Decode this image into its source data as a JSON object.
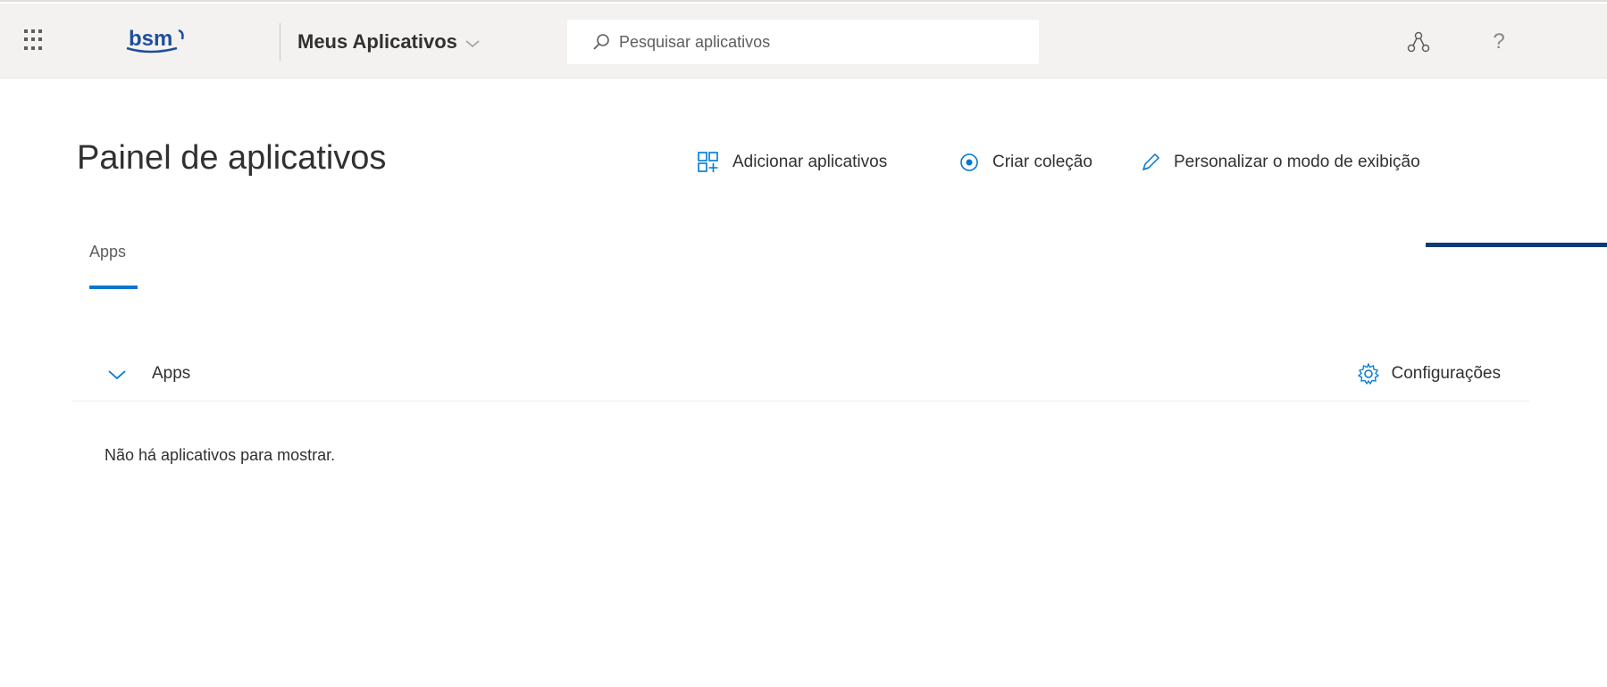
{
  "header": {
    "logo_text": "bsm",
    "app_switcher_label": "Meus Aplicativos",
    "search_placeholder": "Pesquisar aplicativos",
    "help_glyph": "?"
  },
  "page": {
    "title": "Painel de aplicativos",
    "actions": [
      {
        "label": "Adicionar aplicativos",
        "icon": "add-grid-icon"
      },
      {
        "label": "Criar coleção",
        "icon": "target-icon"
      },
      {
        "label": "Personalizar o modo de exibição",
        "icon": "pencil-icon"
      }
    ],
    "tabs": [
      {
        "label": "Apps",
        "selected": true
      }
    ]
  },
  "section": {
    "title": "Apps",
    "settings_label": "Configurações",
    "empty_message": "Não há aplicativos para mostrar."
  },
  "colors": {
    "topbar_bg": "#f3f2f1",
    "accent_blue": "#0078d4",
    "accent_dark": "#0b3a7a"
  }
}
